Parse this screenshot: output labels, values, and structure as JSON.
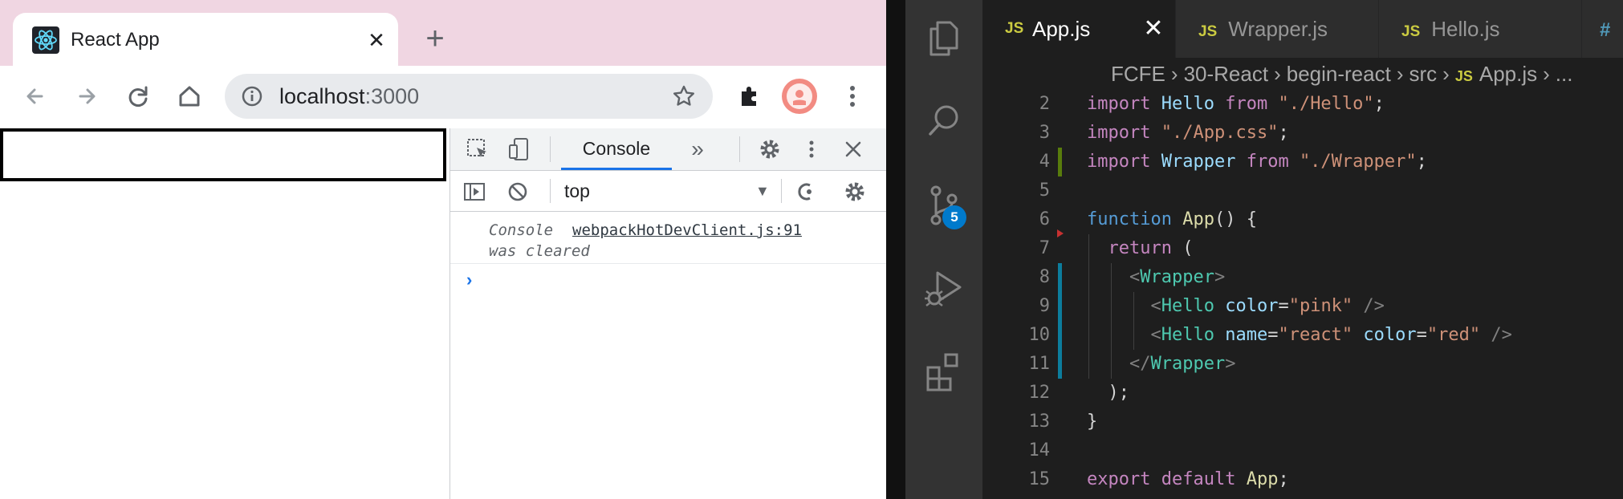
{
  "browser": {
    "tab_title": "React App",
    "tab_close": "✕",
    "new_tab": "+",
    "url_host": "localhost",
    "url_port": ":3000",
    "icons": [
      "back-icon",
      "forward-icon",
      "reload-icon",
      "home-icon",
      "info-icon",
      "star-icon",
      "extensions-icon",
      "profile-avatar",
      "menu-icon"
    ]
  },
  "devtools": {
    "console_tab": "Console",
    "more_tabs": "»",
    "context": "top",
    "cleared_prefix": "Console",
    "cleared_source": "webpackHotDevClient.js:91",
    "cleared_suffix": "was cleared",
    "prompt": "›"
  },
  "vscode": {
    "tabs": [
      {
        "badge": "JS",
        "label": "App.js",
        "active": true
      },
      {
        "badge": "JS",
        "label": "Wrapper.js",
        "active": false
      },
      {
        "badge": "JS",
        "label": "Hello.js",
        "active": false
      },
      {
        "badge": "#",
        "label": "",
        "active": false
      }
    ],
    "active_tab_close": "✕",
    "breadcrumbs": [
      "FCFE",
      "30-React",
      "begin-react",
      "src",
      "App.js",
      "..."
    ],
    "scm_badge": "5",
    "line_numbers": [
      "2",
      "3",
      "4",
      "5",
      "6",
      "7",
      "8",
      "9",
      "10",
      "11",
      "12",
      "13",
      "14",
      "15"
    ],
    "code": {
      "l2_import": "import",
      "l2_name": "Hello",
      "l2_from": "from",
      "l2_path": "\"./Hello\"",
      "l2_end": ";",
      "l3_import": "import",
      "l3_path": "\"./App.css\"",
      "l3_end": ";",
      "l4_import": "import",
      "l4_name": "Wrapper",
      "l4_from": "from",
      "l4_path": "\"./Wrapper\"",
      "l4_end": ";",
      "l6_function": "function",
      "l6_name": "App",
      "l6_rest": "() {",
      "l7_return": "return",
      "l7_rest": " (",
      "l8_open": "<",
      "l8_tag": "Wrapper",
      "l8_close": ">",
      "l9_open": "<",
      "l9_tag": "Hello",
      "l9_attr": "color",
      "l9_eq": "=",
      "l9_val": "\"pink\"",
      "l9_close": " />",
      "l10_open": "<",
      "l10_tag": "Hello",
      "l10_attr1": "name",
      "l10_eq1": "=",
      "l10_val1": "\"react\"",
      "l10_attr2": "color",
      "l10_eq2": "=",
      "l10_val2": "\"red\"",
      "l10_close": " />",
      "l11_open": "</",
      "l11_tag": "Wrapper",
      "l11_close": ">",
      "l12": ");",
      "l13": "}",
      "l15_export": "export",
      "l15_default": "default",
      "l15_name": "App",
      "l15_end": ";"
    }
  }
}
